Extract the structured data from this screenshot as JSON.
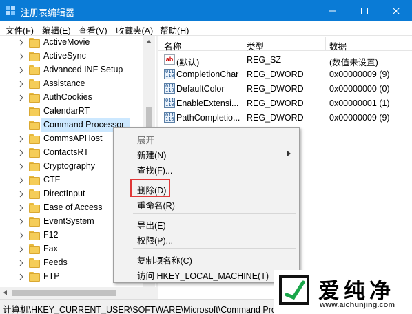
{
  "window": {
    "title": "注册表编辑器",
    "accent_color": "#0a7bd6",
    "controls": [
      "minimize-icon",
      "maximize-icon",
      "close-icon"
    ]
  },
  "menubar": {
    "items": [
      "文件(F)",
      "编辑(E)",
      "查看(V)",
      "收藏夹(A)",
      "帮助(H)"
    ]
  },
  "tree": {
    "items": [
      {
        "label": "ActiveMovie"
      },
      {
        "label": "ActiveSync"
      },
      {
        "label": "Advanced INF Setup"
      },
      {
        "label": "Assistance"
      },
      {
        "label": "AuthCookies"
      },
      {
        "label": "CalendarRT"
      },
      {
        "label": "Command Processor",
        "selected": true
      },
      {
        "label": "CommsAPHost"
      },
      {
        "label": "ContactsRT"
      },
      {
        "label": "Cryptography"
      },
      {
        "label": "CTF"
      },
      {
        "label": "DirectInput"
      },
      {
        "label": "Ease of Access"
      },
      {
        "label": "EventSystem"
      },
      {
        "label": "F12"
      },
      {
        "label": "Fax"
      },
      {
        "label": "Feeds"
      },
      {
        "label": "FTP"
      }
    ]
  },
  "values_list": {
    "headers": {
      "name": "名称",
      "type": "类型",
      "data": "数据"
    },
    "rows": [
      {
        "icon": "string-value-icon",
        "name": "(默认)",
        "type": "REG_SZ",
        "data": "(数值未设置)"
      },
      {
        "icon": "binary-value-icon",
        "name": "CompletionChar",
        "type": "REG_DWORD",
        "data": "0x00000009 (9)"
      },
      {
        "icon": "binary-value-icon",
        "name": "DefaultColor",
        "type": "REG_DWORD",
        "data": "0x00000000 (0)"
      },
      {
        "icon": "binary-value-icon",
        "name": "EnableExtensi...",
        "type": "REG_DWORD",
        "data": "0x00000001 (1)"
      },
      {
        "icon": "binary-value-icon",
        "name": "PathCompletio...",
        "type": "REG_DWORD",
        "data": "0x00000009 (9)"
      }
    ]
  },
  "context_menu": {
    "expand": "展开",
    "new": "新建(N)",
    "find": "查找(F)...",
    "delete": "删除(D)",
    "rename": "重命名(R)",
    "export": "导出(E)",
    "permissions": "权限(P)...",
    "copy_key_name": "复制项名称(C)",
    "goto": "访问 HKEY_LOCAL_MACHINE(T)",
    "highlight_color": "#e03838"
  },
  "statusbar": {
    "path": "计算机\\HKEY_CURRENT_USER\\SOFTWARE\\Microsoft\\Command Proc"
  },
  "watermark": {
    "brand": "爱纯净",
    "url": "www.aichunjing.com"
  }
}
